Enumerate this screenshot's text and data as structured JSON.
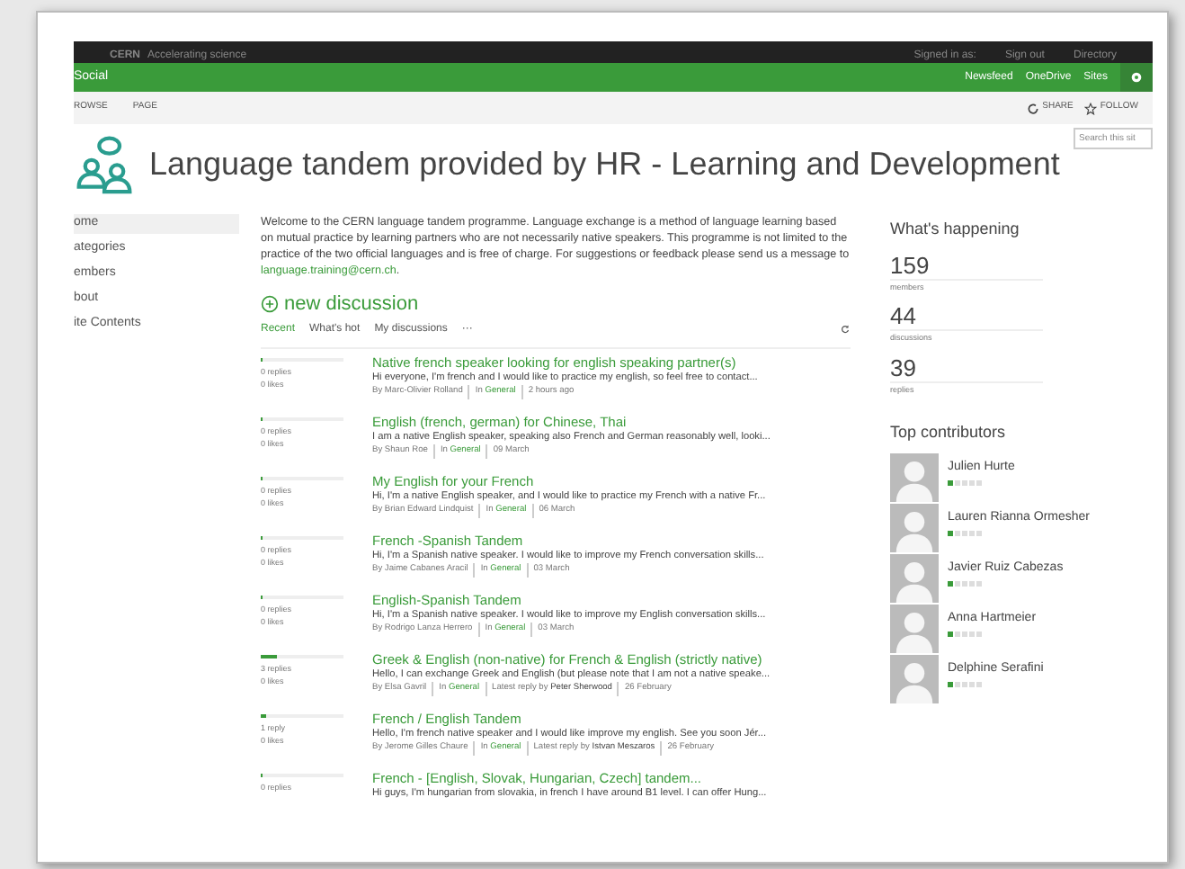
{
  "top_bar": {
    "brand": "CERN",
    "tagline": "Accelerating science",
    "signed_in": "Signed in as:",
    "links": [
      "Sign out",
      "Directory"
    ]
  },
  "suite_bar": {
    "title": "Social",
    "links": [
      "Newsfeed",
      "OneDrive",
      "Sites"
    ]
  },
  "ribbon": {
    "tabs": [
      "ROWSE",
      "PAGE"
    ],
    "actions": [
      "SHARE",
      "FOLLOW"
    ]
  },
  "search": {
    "placeholder": "Search this sit"
  },
  "site_title": "Language tandem provided by HR - Learning and Development",
  "nav": [
    {
      "label": "ome",
      "selected": true
    },
    {
      "label": "ategories",
      "selected": false
    },
    {
      "label": "embers",
      "selected": false
    },
    {
      "label": "bout",
      "selected": false
    },
    {
      "label": "ite Contents",
      "selected": false
    }
  ],
  "intro": "Welcome to the CERN language tandem programme. Language exchange is a method of language learning based on mutual practice by learning partners who are not necessarily native speakers. This programme is not limited to the practice of the two official languages and is free of charge.  For suggestions or feedback please send us a message to ",
  "intro_link": "language.training@cern.ch",
  "intro_end": ".",
  "new_discussion": "new discussion",
  "filters": [
    {
      "label": "Recent",
      "selected": true
    },
    {
      "label": "What's hot",
      "selected": false
    },
    {
      "label": "My discussions",
      "selected": false
    },
    {
      "label": "···",
      "selected": false
    }
  ],
  "discussions": [
    {
      "level": 0.02,
      "replies": "0 replies",
      "likes": "0 likes",
      "title": "Native french speaker looking for english speaking partner(s)",
      "snippet": "Hi everyone, I'm french and I would like to practice my english, so feel free to contact...",
      "author": "By Marc-Olivier Rolland",
      "in_label": "In",
      "category": "General",
      "date": "2 hours ago"
    },
    {
      "level": 0.02,
      "replies": "0 replies",
      "likes": "0 likes",
      "title": "English (french, german) for Chinese, Thai",
      "snippet": "I am a native English speaker, speaking also French and German reasonably well, looki...",
      "author": "By Shaun Roe",
      "in_label": "In",
      "category": "General",
      "date": "09 March"
    },
    {
      "level": 0.02,
      "replies": "0 replies",
      "likes": "0 likes",
      "title": "My English for your French",
      "snippet": "Hi, I'm a native English speaker, and I would like to practice my French with a native Fr...",
      "author": "By Brian Edward Lindquist",
      "in_label": "In",
      "category": "General",
      "date": "06 March"
    },
    {
      "level": 0.02,
      "replies": "0 replies",
      "likes": "0 likes",
      "title": "French -Spanish Tandem",
      "snippet": "Hi, I'm a Spanish native speaker. I would like to improve my French conversation skills...",
      "author": "By Jaime Cabanes Aracil",
      "in_label": "In",
      "category": "General",
      "date": "03 March"
    },
    {
      "level": 0.02,
      "replies": "0 replies",
      "likes": "0 likes",
      "title": "English-Spanish Tandem",
      "snippet": "Hi, I'm a Spanish native speaker. I would like to improve my English conversation skills...",
      "author": "By Rodrigo Lanza Herrero",
      "in_label": "In",
      "category": "General",
      "date": "03 March"
    },
    {
      "level": 0.2,
      "replies": "3 replies",
      "likes": "0 likes",
      "title": "Greek & English (non-native) for French & English (strictly native)",
      "snippet": "Hello, I can exchange Greek and English (but please note that I am not a native speake...",
      "author": "By Elsa Gavril",
      "in_label": "In",
      "category": "General",
      "latest_label": "Latest reply by",
      "latest": "Peter Sherwood",
      "date": "26 February"
    },
    {
      "level": 0.06,
      "replies": "1 reply",
      "likes": "0 likes",
      "title": "French / English Tandem",
      "snippet": "Hello, I'm french native speaker and I would like improve my english. See you soon Jér...",
      "author": "By Jerome Gilles Chaure",
      "in_label": "In",
      "category": "General",
      "latest_label": "Latest reply by",
      "latest": "Istvan Meszaros",
      "date": "26 February"
    },
    {
      "level": 0.02,
      "replies": "0 replies",
      "title": "French - [English, Slovak, Hungarian, Czech] tandem...",
      "snippet": "Hi guys, I'm hungarian from slovakia, in french I have around B1 level. I can offer Hung..."
    }
  ],
  "happening": {
    "title": "What's happening",
    "stats": [
      {
        "value": "159",
        "label": "members"
      },
      {
        "value": "44",
        "label": "discussions"
      },
      {
        "value": "39",
        "label": "replies"
      }
    ]
  },
  "contributors": {
    "title": "Top contributors",
    "people": [
      {
        "name": "Julien Hurte",
        "stars": 1
      },
      {
        "name": "Lauren Rianna Ormesher",
        "stars": 1
      },
      {
        "name": "Javier Ruiz Cabezas",
        "stars": 1
      },
      {
        "name": "Anna Hartmeier",
        "stars": 1
      },
      {
        "name": "Delphine Serafini",
        "stars": 1
      }
    ]
  }
}
